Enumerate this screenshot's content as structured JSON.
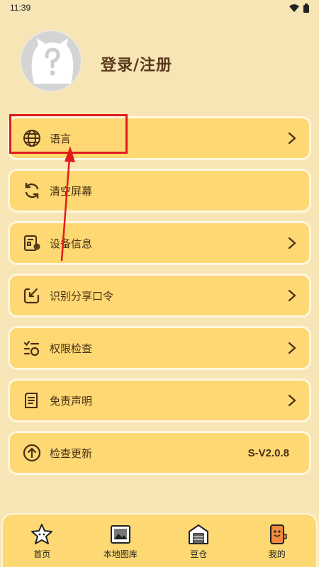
{
  "status_bar": {
    "time": "11:39"
  },
  "profile": {
    "login_label": "登录/注册"
  },
  "menu": {
    "items": [
      {
        "label": "语言",
        "icon": "globe-icon",
        "has_chevron": true
      },
      {
        "label": "清空屏幕",
        "icon": "refresh-icon",
        "has_chevron": false
      },
      {
        "label": "设备信息",
        "icon": "device-info-icon",
        "has_chevron": true
      },
      {
        "label": "识别分享口令",
        "icon": "share-code-icon",
        "has_chevron": true
      },
      {
        "label": "权限检查",
        "icon": "checklist-icon",
        "has_chevron": true
      },
      {
        "label": "免责声明",
        "icon": "document-icon",
        "has_chevron": true
      },
      {
        "label": "检查更新",
        "icon": "upload-circle-icon",
        "value": "S-V2.0.8"
      }
    ]
  },
  "bottom_nav": {
    "items": [
      {
        "label": "首页",
        "icon": "star-character-icon"
      },
      {
        "label": "本地图库",
        "icon": "gallery-icon"
      },
      {
        "label": "豆仓",
        "icon": "warehouse-icon"
      },
      {
        "label": "我的",
        "icon": "profile-character-icon",
        "active": true
      }
    ]
  },
  "colors": {
    "background": "#f8e5b5",
    "card": "#fdd873",
    "text": "#4a2f14",
    "annotation": "#e11c1c"
  }
}
